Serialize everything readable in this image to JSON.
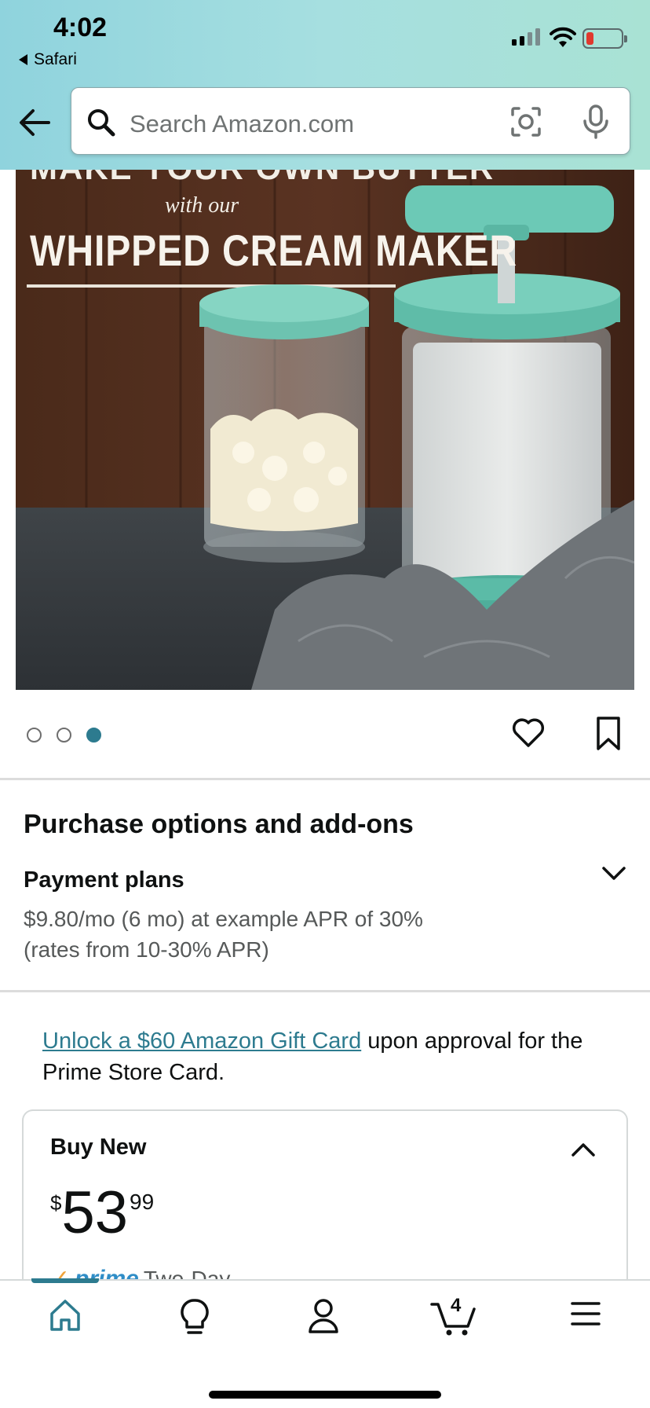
{
  "status_bar": {
    "time": "4:02",
    "back_app": "Safari"
  },
  "header": {
    "search_placeholder": "Search Amazon.com",
    "accent_color": "#2d7b8f"
  },
  "product_image": {
    "text_top": "MAKE YOUR OWN BUTTER",
    "text_mid": "with our",
    "text_big": "WHIPPED CREAM MAKER",
    "carousel_total": 3,
    "carousel_active_index": 2
  },
  "purchase_options": {
    "title": "Purchase options and add-ons",
    "payment_plans": {
      "title": "Payment plans",
      "line1": "$9.80/mo (6 mo) at example APR of 30%",
      "line2": "(rates from 10-30% APR)"
    }
  },
  "promo": {
    "link_text": "Unlock a $60 Amazon Gift Card",
    "rest_text": " upon approval for the Prime Store Card."
  },
  "buy_new": {
    "title": "Buy New",
    "currency": "$",
    "price_whole": "53",
    "price_fraction": "99",
    "prime_label": "prime",
    "shipping": "Two-Day"
  },
  "tabbar": {
    "items": [
      "home",
      "ideas",
      "account",
      "cart",
      "menu"
    ],
    "active": "home",
    "cart_count": "4"
  }
}
